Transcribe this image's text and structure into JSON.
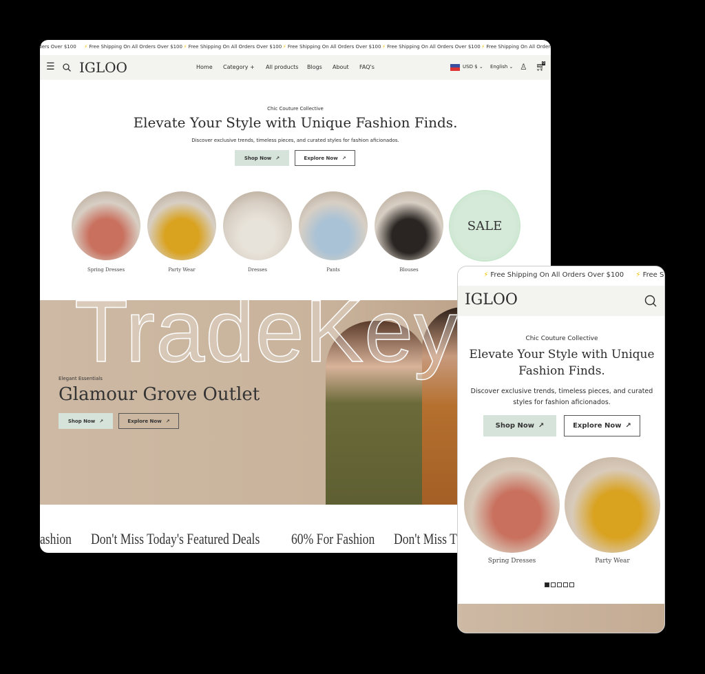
{
  "announcement": {
    "text": "Free Shipping On All Orders Over $100",
    "icon": "lightning-icon"
  },
  "header": {
    "logo": "IGLOO",
    "nav": [
      "Home",
      "Category +",
      "All products",
      "Blogs",
      "About",
      "FAQ's"
    ],
    "currency": "USD $",
    "language": "English",
    "cart_count": "0"
  },
  "hero": {
    "eyebrow": "Chic Couture Collective",
    "title": "Elevate Your Style with Unique Fashion Finds.",
    "description": "Discover exclusive trends, timeless pieces, and curated styles for fashion aficionados.",
    "shop": "Shop Now",
    "explore": "Explore Now"
  },
  "categories": [
    {
      "label": "Spring Dresses",
      "color": "#c9705e"
    },
    {
      "label": "Party Wear",
      "color": "#d9a21f"
    },
    {
      "label": "Dresses",
      "color": "#e8e3da"
    },
    {
      "label": "Pants",
      "color": "#a9c2d6"
    },
    {
      "label": "Blouses",
      "color": "#2a2522"
    },
    {
      "label": "SALE",
      "color": "#d6ead9"
    }
  ],
  "banner": {
    "eyebrow": "Elegant Essentials",
    "title": "Glamour Grove Outlet",
    "shop": "Shop Now",
    "explore": "Explore Now"
  },
  "marquee": [
    "ashion",
    "Don't Miss Today's Featured Deals",
    "60% For Fashion",
    "Don't Miss T"
  ],
  "colors": {
    "accent": "#d6e3da",
    "header_bg": "#f3f4f0",
    "banner_bg": "#cdb9a4"
  },
  "watermark": "TradeKey.com"
}
